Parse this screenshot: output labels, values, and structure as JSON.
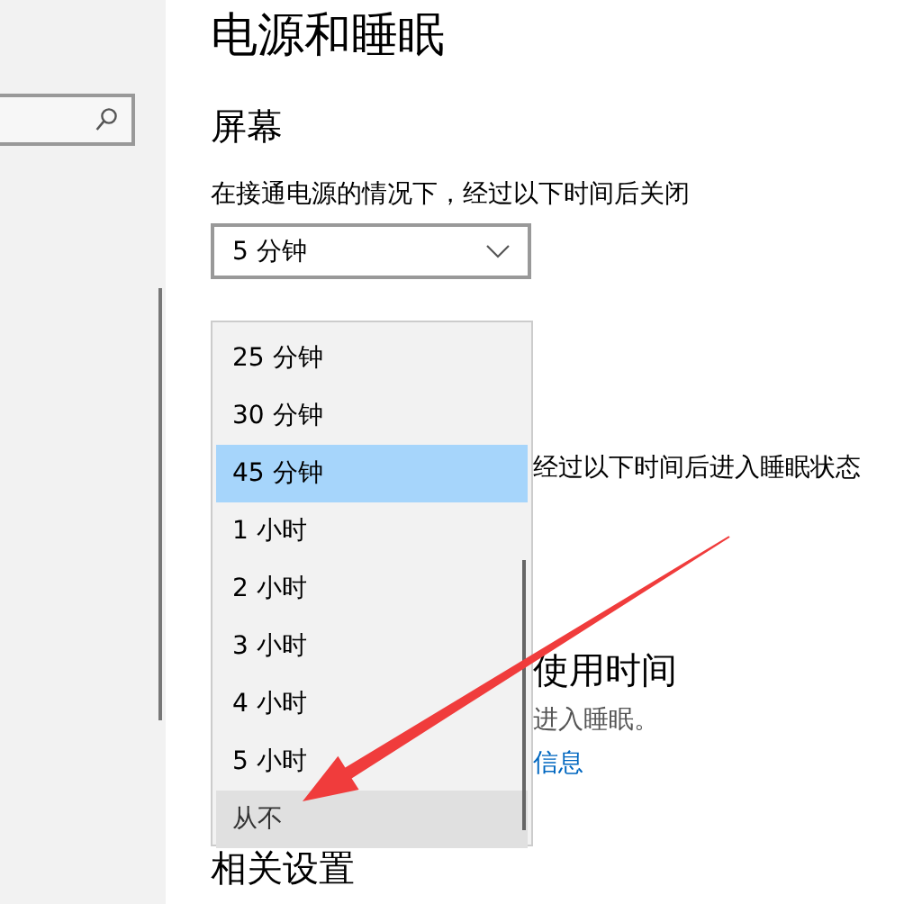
{
  "page": {
    "title": "电源和睡眠"
  },
  "screen_section": {
    "heading": "屏幕",
    "label": "在接通电源的情况下，经过以下时间后关闭",
    "dropdown": {
      "value": "5 分钟",
      "expanded": true
    }
  },
  "dropdown_options": [
    {
      "label": "25 分钟",
      "selected": false,
      "hovered": false
    },
    {
      "label": "30 分钟",
      "selected": false,
      "hovered": false
    },
    {
      "label": "45 分钟",
      "selected": true,
      "hovered": false
    },
    {
      "label": "1 小时",
      "selected": false,
      "hovered": false
    },
    {
      "label": "2 小时",
      "selected": false,
      "hovered": false
    },
    {
      "label": "3 小时",
      "selected": false,
      "hovered": false
    },
    {
      "label": "4 小时",
      "selected": false,
      "hovered": false
    },
    {
      "label": "5 小时",
      "selected": false,
      "hovered": false
    },
    {
      "label": "从不",
      "selected": false,
      "hovered": true
    }
  ],
  "sleep_label": "经过以下时间后进入睡眠状态",
  "usage_section": {
    "heading": "使用时间",
    "text": "进入睡眠。",
    "link": "信息"
  },
  "related_heading": "相关设置"
}
